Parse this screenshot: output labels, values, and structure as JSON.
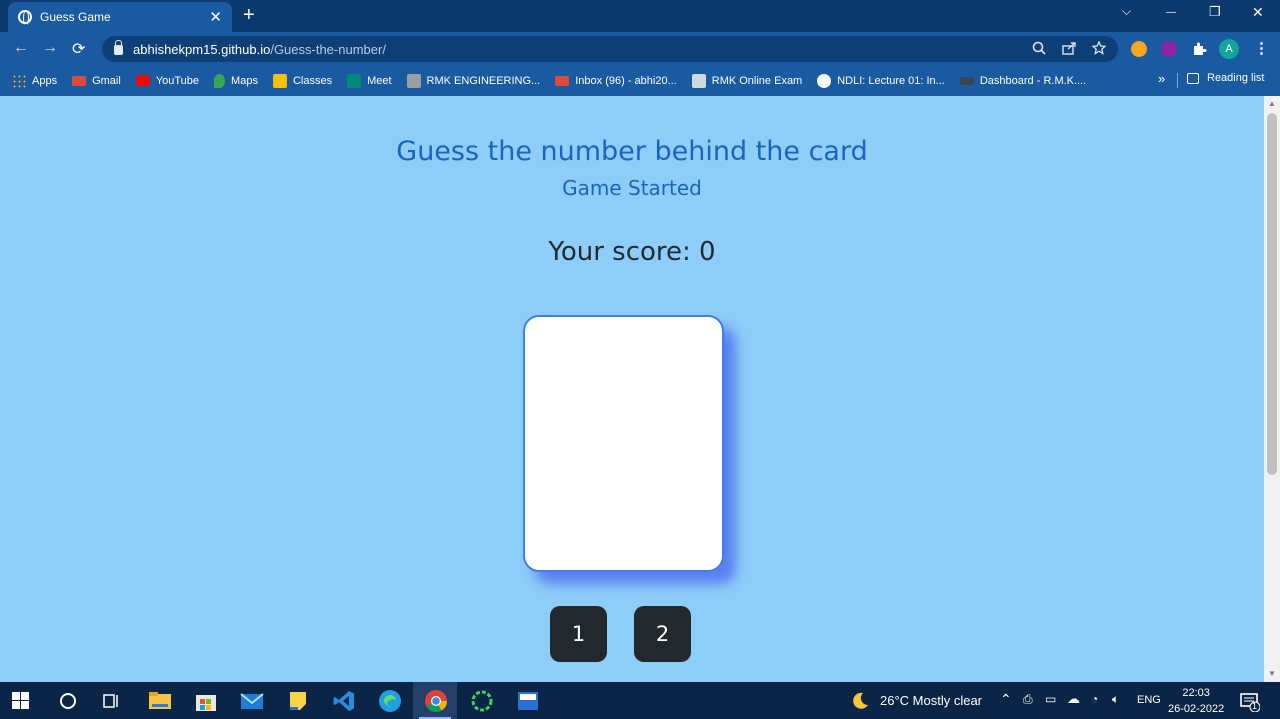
{
  "browser": {
    "tab_title": "Guess Game",
    "tab_close": "✕",
    "new_tab": "+",
    "window_controls": {
      "dropdown": "⌵",
      "minimize": "—",
      "restore": "❐",
      "close": "✕"
    },
    "nav": {
      "back": "←",
      "forward": "→",
      "reload": "⟳"
    },
    "url_host": "abhishekpm15.github.io",
    "url_path": "/Guess-the-number/",
    "avatar_letter": "A",
    "menu": "⋮"
  },
  "bookmarks": {
    "items": [
      {
        "label": "Apps",
        "color": "#ffb200"
      },
      {
        "label": "Gmail",
        "color": "#e04a3d"
      },
      {
        "label": "YouTube",
        "color": "#ff0000"
      },
      {
        "label": "Maps",
        "color": "#34a853"
      },
      {
        "label": "Classes",
        "color": "#f4c20d"
      },
      {
        "label": "Meet",
        "color": "#00897b"
      },
      {
        "label": "RMK ENGINEERING...",
        "color": "#9aa0a6"
      },
      {
        "label": "Inbox (96) - abhi20...",
        "color": "#e04a3d"
      },
      {
        "label": "RMK Online Exam",
        "color": "#cfd8dc"
      },
      {
        "label": "NDLI: Lecture 01: In...",
        "color": "#ffffff"
      },
      {
        "label": "Dashboard - R.M.K....",
        "color": "#37474f"
      }
    ],
    "more": "»",
    "reading_list": "Reading list"
  },
  "page": {
    "title": "Guess the number behind the card",
    "status": "Game Started",
    "score_label": "Your score: 0",
    "buttons": [
      "1",
      "2"
    ]
  },
  "taskbar": {
    "weather": "26°C  Mostly clear",
    "language": "ENG",
    "time": "22:03",
    "date": "26-02-2022",
    "notification_count": "1"
  }
}
